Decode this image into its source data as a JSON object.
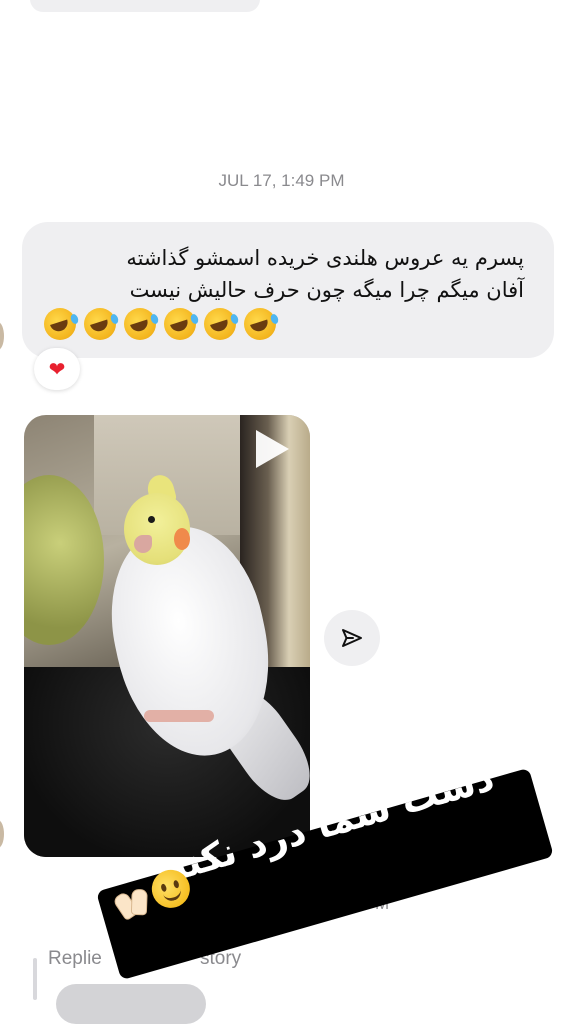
{
  "thread": {
    "date_separator": "JUL 17, 1:49 PM",
    "message": {
      "line1": "پسرم یه عروس هلندی خریده اسمشو گذاشته",
      "line2": "آفان میگم چرا میگه چون حرف حالیش نیست",
      "emoji_count": 6,
      "emoji_name": "rofl-emoji",
      "reaction_icon": "heart-icon",
      "reaction_glyph": "❤"
    },
    "media": {
      "type": "video",
      "play_icon": "play-icon",
      "share_icon": "send-icon"
    },
    "next_timestamp_fragment": "M",
    "reply_label_left": "Replie",
    "reply_label_right": "story"
  },
  "sticker": {
    "text": "دست شما درد نکنه",
    "emojis": [
      "smile-icon",
      "raised-hands-icon"
    ]
  },
  "colors": {
    "bubble": "#efeff1",
    "timestamp": "#8a8a8e",
    "sticker_bg": "#000000",
    "heart": "#e8202e"
  }
}
